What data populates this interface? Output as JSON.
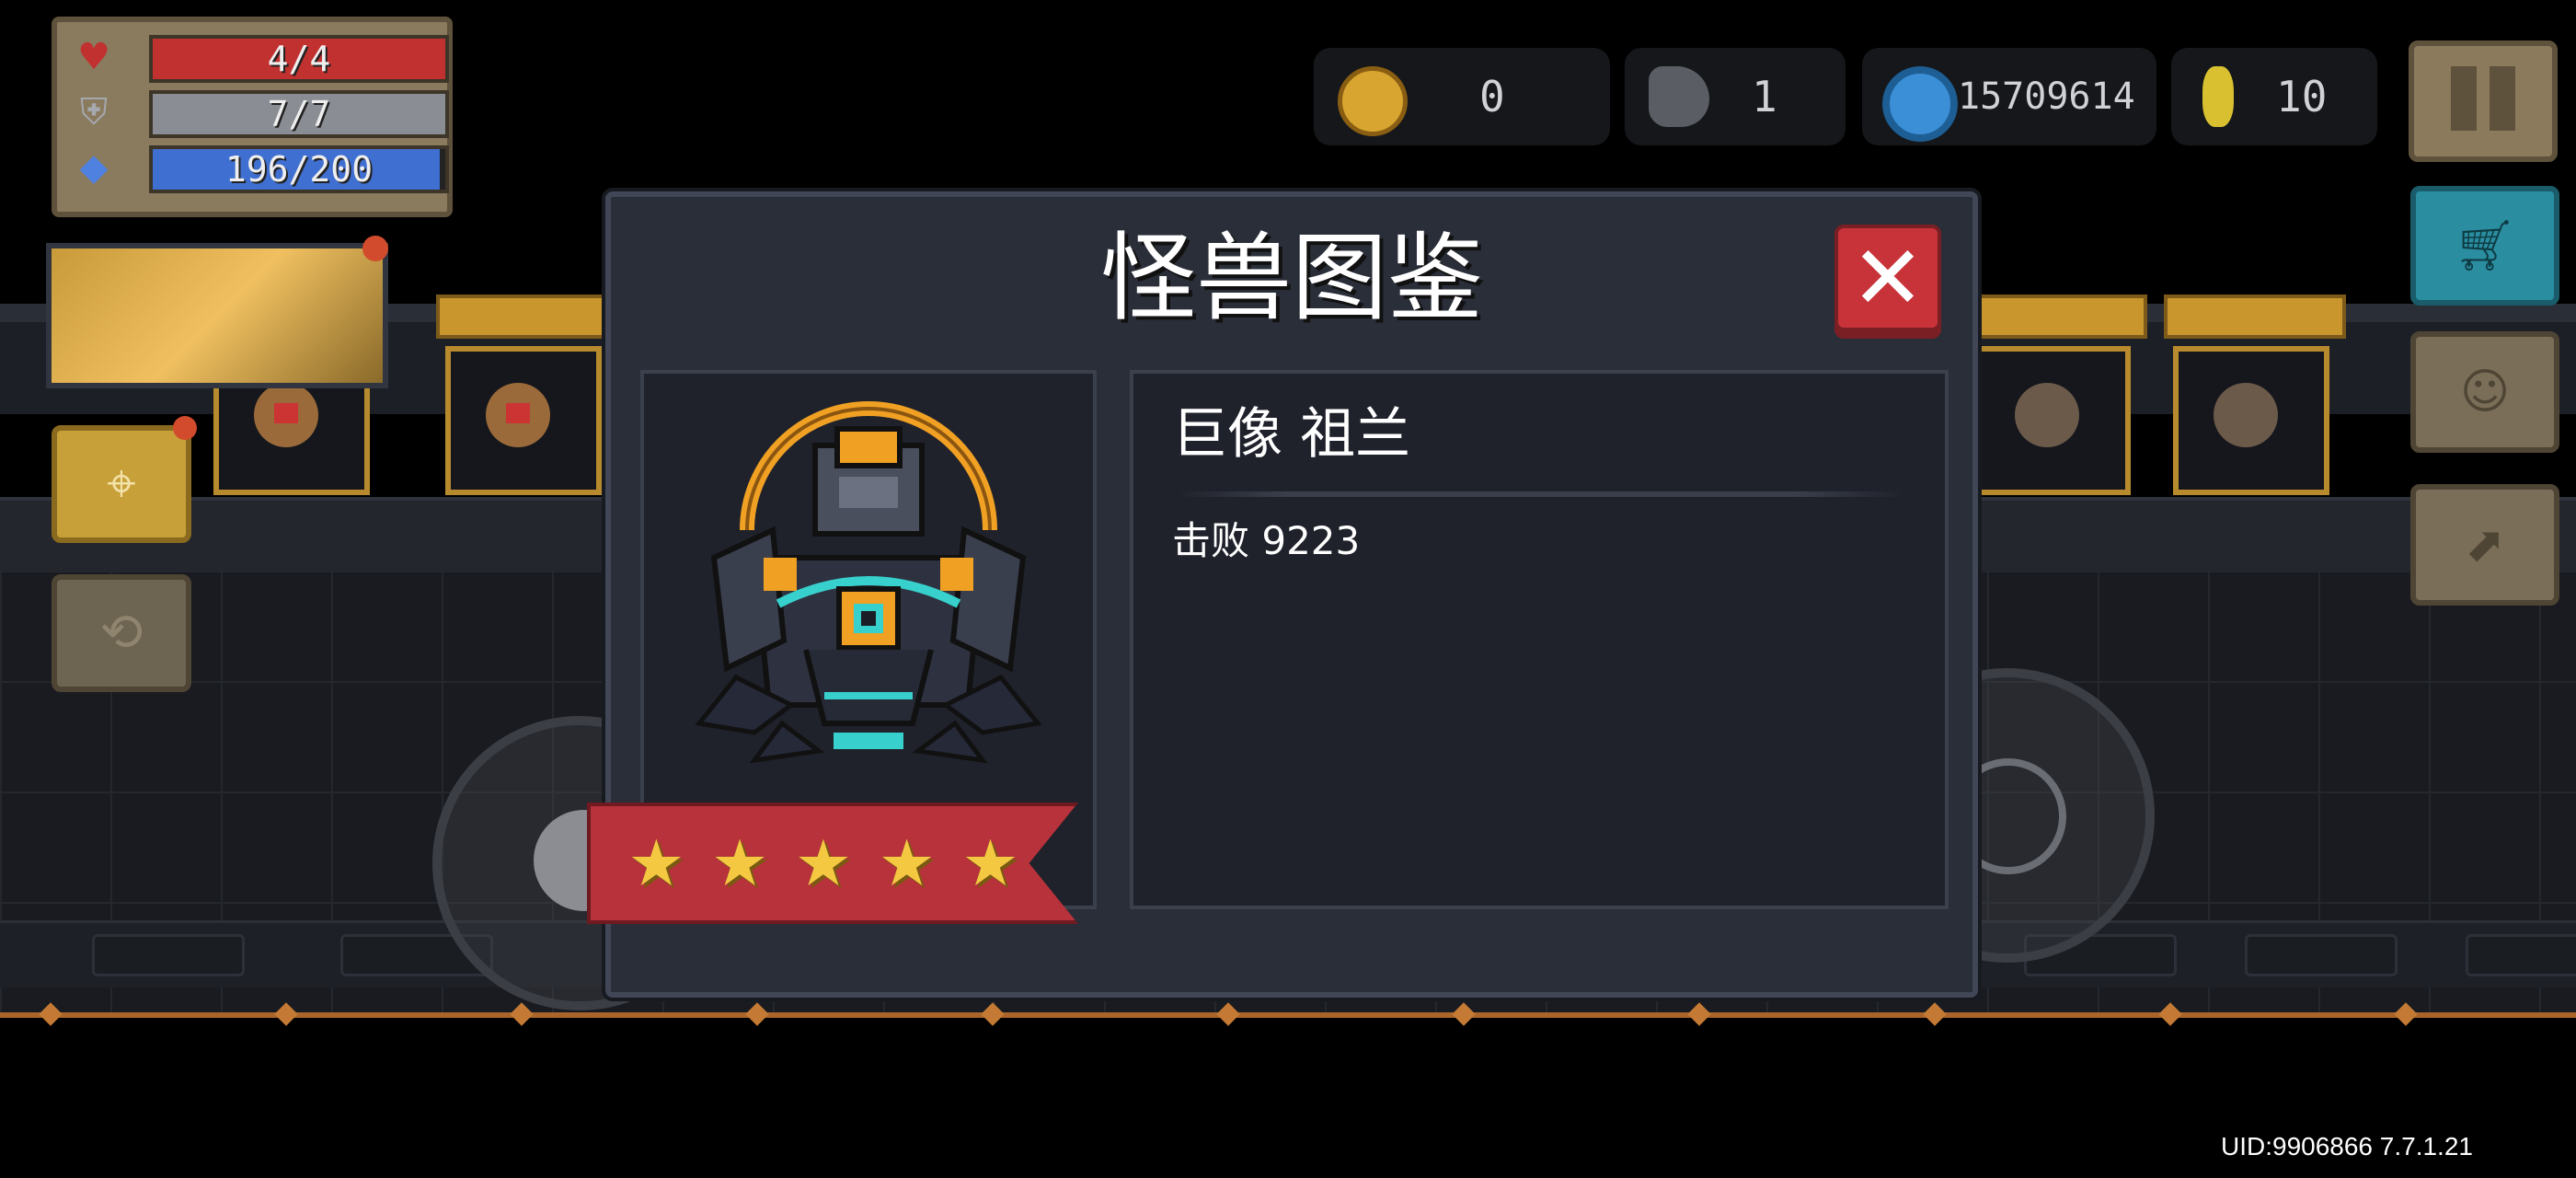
{
  "hud": {
    "health": {
      "icon": "heart-icon",
      "text": "4/4",
      "fraction": 1.0,
      "color": "#c0312f"
    },
    "armor": {
      "icon": "shield-icon",
      "text": "7/7",
      "fraction": 1.0,
      "color": "#8a8d93"
    },
    "energy": {
      "icon": "diamond-icon",
      "text": "196/200",
      "fraction": 0.98,
      "color": "#3f6fd0"
    }
  },
  "currencies": [
    {
      "icon": "gold-crown-coin-icon",
      "value": "0",
      "color": "#d8a630"
    },
    {
      "icon": "fish-icon",
      "value": "1",
      "color": "#8a8d93"
    },
    {
      "icon": "blue-gem-icon",
      "value": "15709614",
      "color": "#3a8fd6"
    },
    {
      "icon": "gold-coin-icon",
      "value": "10",
      "color": "#d8c030"
    }
  ],
  "dialog": {
    "title": "怪兽图鉴",
    "close_label": "✕",
    "monster": {
      "name": "巨像  祖兰",
      "kills": "击败 9223",
      "rating": 5,
      "stars": [
        "★",
        "★",
        "★",
        "★",
        "★"
      ]
    }
  },
  "footer": {
    "uid": "UID:9906866 7.7.1.21"
  }
}
